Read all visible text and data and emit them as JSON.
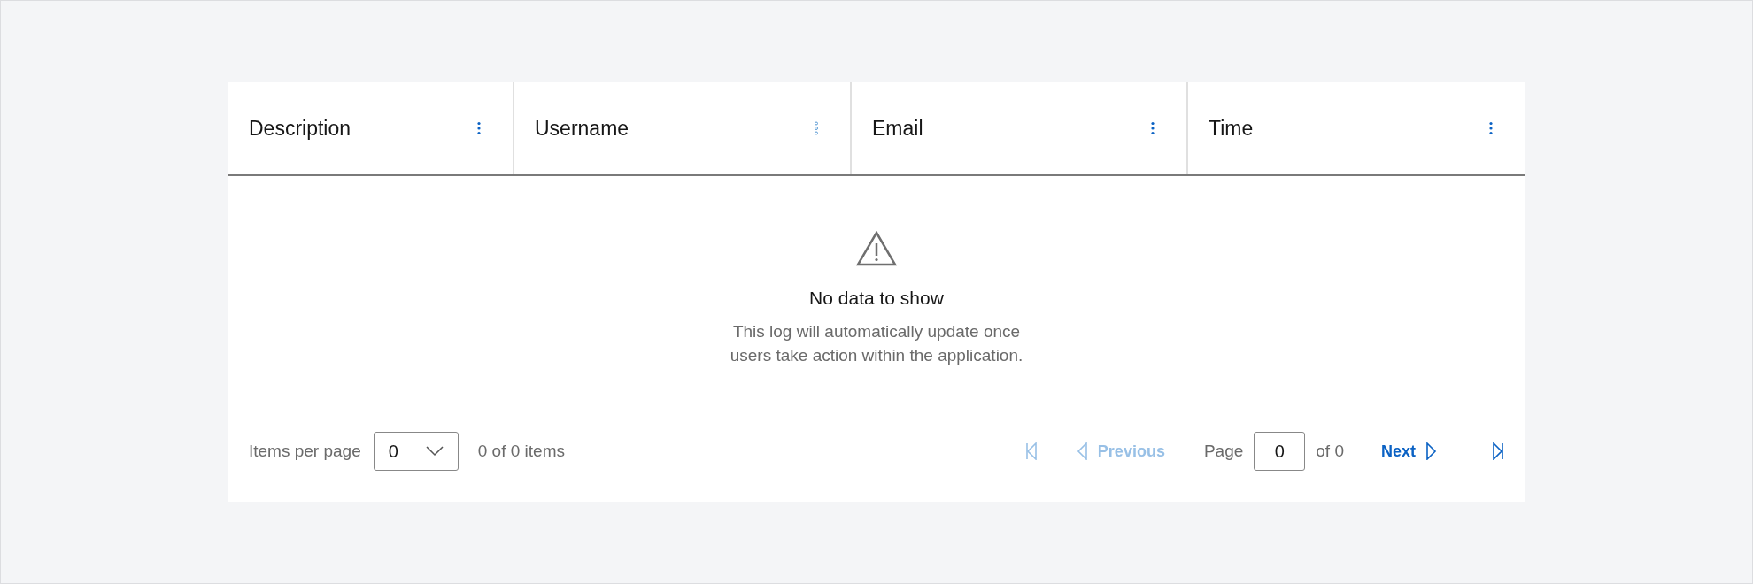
{
  "table": {
    "columns": [
      {
        "label": "Description",
        "menu_hovered": false
      },
      {
        "label": "Username",
        "menu_hovered": true
      },
      {
        "label": "Email",
        "menu_hovered": false
      },
      {
        "label": "Time",
        "menu_hovered": false
      }
    ],
    "empty_state": {
      "title": "No data to show",
      "message": "This log will automatically update once users take action within the application."
    }
  },
  "pagination": {
    "items_per_page_label": "Items per page",
    "items_per_page": "0",
    "item_range": "0 of 0 items",
    "controls_before": [
      {
        "kind": "first",
        "disabled": true
      },
      {
        "kind": "previous",
        "label": "Previous",
        "disabled": true
      }
    ],
    "page_label": "Page",
    "page": "0",
    "page_total": "of 0",
    "controls_after": [
      {
        "kind": "next",
        "label": "Next",
        "disabled": false
      },
      {
        "kind": "last",
        "disabled": false
      }
    ]
  }
}
